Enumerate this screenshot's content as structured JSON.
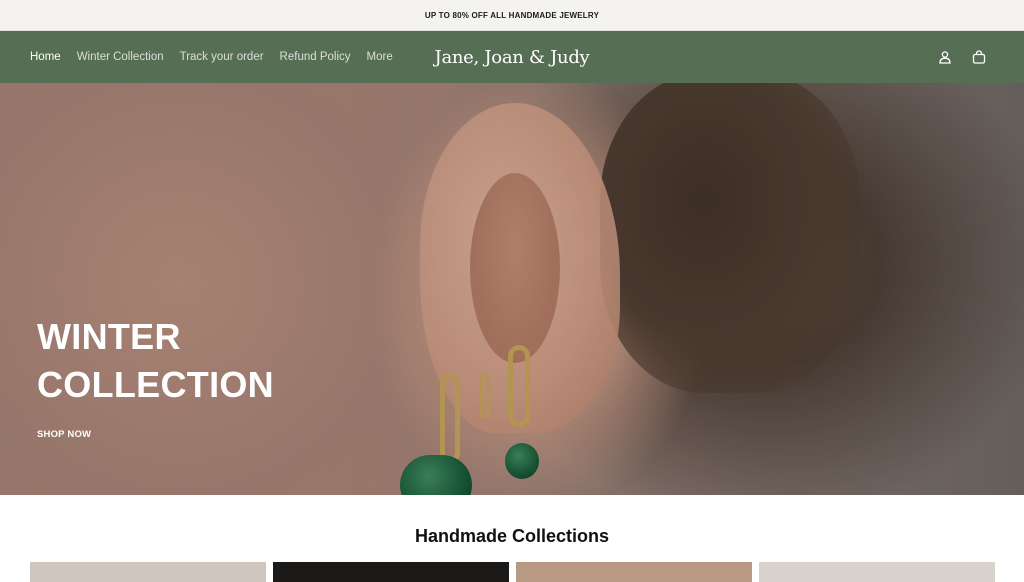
{
  "announcement": "UP TO 80% OFF ALL HANDMADE JEWELRY",
  "header": {
    "nav": [
      {
        "label": "Home",
        "active": true
      },
      {
        "label": "Winter Collection",
        "active": false
      },
      {
        "label": "Track your order",
        "active": false
      },
      {
        "label": "Refund Policy",
        "active": false
      },
      {
        "label": "More",
        "active": false
      }
    ],
    "brand": "Jane, Joan & Judy",
    "icons": [
      "account-icon",
      "cart-icon"
    ]
  },
  "hero": {
    "title": "WINTER\nCOLLECTION",
    "cta": "SHOP NOW"
  },
  "collections": {
    "title": "Handmade Collections",
    "cards": [
      {
        "color": "#cfc7bf"
      },
      {
        "color": "#1c1a19"
      },
      {
        "color": "#b89a84"
      },
      {
        "color": "#d8d2cc"
      }
    ]
  },
  "colors": {
    "header_bg": "#566e53",
    "announcement_bg": "#f4f3f1",
    "gem_green": "#145a38",
    "gold": "#c8a45a"
  }
}
